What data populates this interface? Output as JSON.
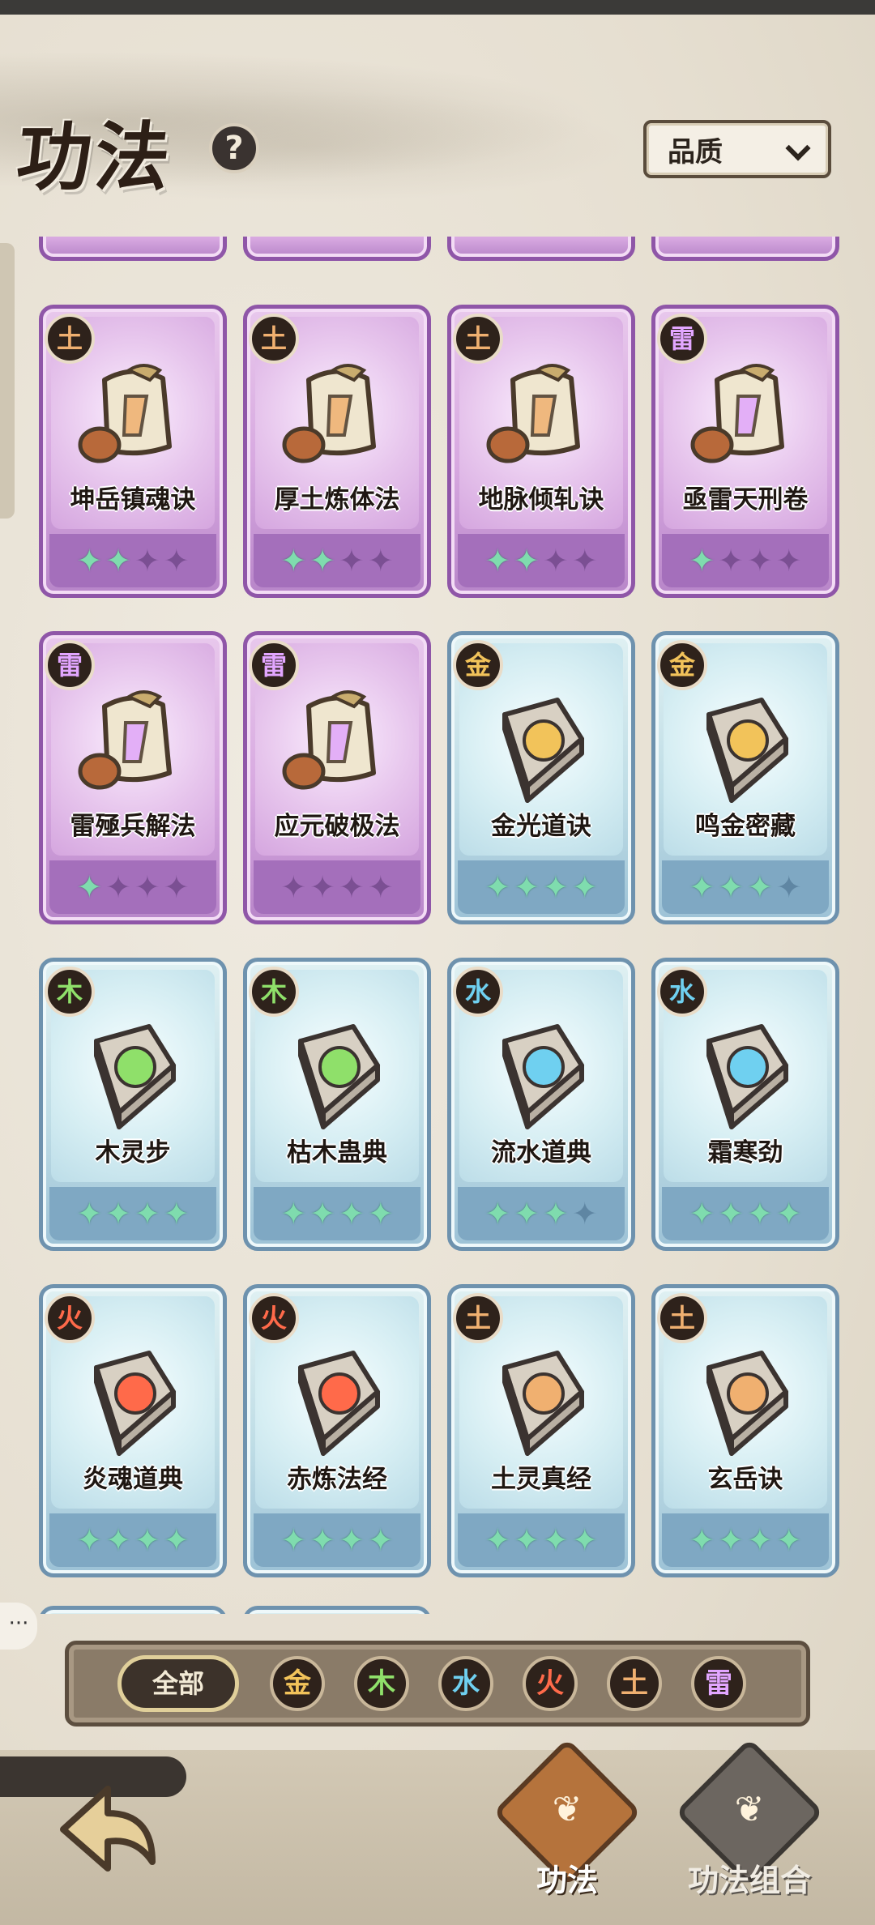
{
  "header": {
    "title": "功法",
    "help_icon": "question-mark-icon",
    "sort": {
      "label": "品质",
      "icon": "chevron-down-icon"
    }
  },
  "colors": {
    "purple_card": "#d7a8e0",
    "blue_card": "#bfdde6",
    "star_on": "#7fdcae",
    "elements": {
      "金": "#f2c35a",
      "木": "#8fe06a",
      "水": "#6fd0f0",
      "火": "#ff6a4a",
      "土": "#f0b070",
      "雷": "#e2a6ff"
    }
  },
  "cards": [
    {
      "name": "坤岳镇魂诀",
      "element": "土",
      "rarity": "purple",
      "stars": 2,
      "art": "scroll-earth-icon"
    },
    {
      "name": "厚土炼体法",
      "element": "土",
      "rarity": "purple",
      "stars": 2,
      "art": "scroll-axe-icon"
    },
    {
      "name": "地脉倾轧诀",
      "element": "土",
      "rarity": "purple",
      "stars": 2,
      "art": "scroll-rock-icon"
    },
    {
      "name": "亟雷天刑卷",
      "element": "雷",
      "rarity": "purple",
      "stars": 1,
      "art": "scroll-lightning-icon"
    },
    {
      "name": "雷殛兵解法",
      "element": "雷",
      "rarity": "purple",
      "stars": 1,
      "art": "scroll-thunder-icon"
    },
    {
      "name": "应元破极法",
      "element": "雷",
      "rarity": "purple",
      "stars": 0,
      "art": "scroll-spirit-icon"
    },
    {
      "name": "金光道诀",
      "element": "金",
      "rarity": "blue",
      "stars": 4,
      "art": "book-gold-burst-icon"
    },
    {
      "name": "鸣金密藏",
      "element": "金",
      "rarity": "blue",
      "stars": 3,
      "art": "book-shield-icon"
    },
    {
      "name": "木灵步",
      "element": "木",
      "rarity": "blue",
      "stars": 4,
      "art": "book-leaf-icon"
    },
    {
      "name": "枯木蛊典",
      "element": "木",
      "rarity": "blue",
      "stars": 4,
      "art": "book-poison-icon"
    },
    {
      "name": "流水道典",
      "element": "水",
      "rarity": "blue",
      "stars": 3,
      "art": "book-wave-icon"
    },
    {
      "name": "霜寒劲",
      "element": "水",
      "rarity": "blue",
      "stars": 4,
      "art": "book-ice-icon"
    },
    {
      "name": "炎魂道典",
      "element": "火",
      "rarity": "blue",
      "stars": 4,
      "art": "book-fireball-icon"
    },
    {
      "name": "赤炼法经",
      "element": "火",
      "rarity": "blue",
      "stars": 4,
      "art": "book-flame-icon"
    },
    {
      "name": "土灵真经",
      "element": "土",
      "rarity": "blue",
      "stars": 4,
      "art": "book-boulder-icon"
    },
    {
      "name": "玄岳诀",
      "element": "土",
      "rarity": "blue",
      "stars": 4,
      "art": "book-axe-icon"
    }
  ],
  "filter": {
    "all_label": "全部",
    "elements": [
      "金",
      "木",
      "水",
      "火",
      "土",
      "雷"
    ]
  },
  "bottom_nav": {
    "back_icon": "back-arrow-icon",
    "tabs": [
      {
        "label": "功法",
        "active": true,
        "icon": "technique-book-icon"
      },
      {
        "label": "功法组合",
        "active": false,
        "icon": "technique-combo-icon"
      }
    ]
  },
  "side_chat_icon": "chat-bubble-icon"
}
